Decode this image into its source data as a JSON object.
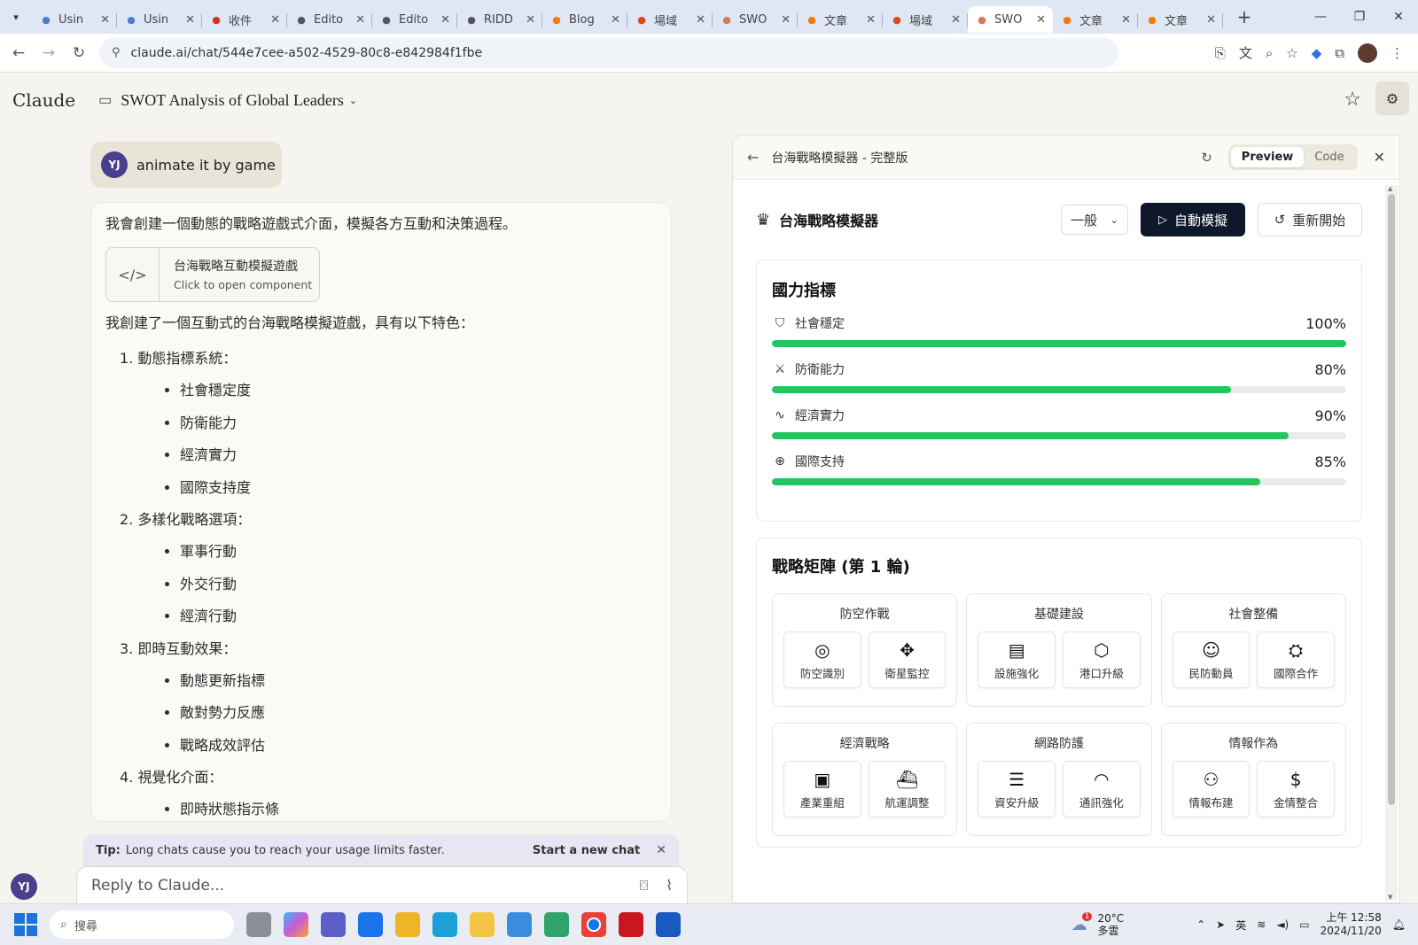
{
  "browser": {
    "tabs": [
      {
        "label": "Usin",
        "icon": "web-icon",
        "color": "#4a7fd0"
      },
      {
        "label": "Usin",
        "icon": "web-icon",
        "color": "#4a7fd0"
      },
      {
        "label": "收件",
        "icon": "gmail-icon",
        "color": "#d93025"
      },
      {
        "label": "Edito",
        "icon": "web-icon",
        "color": "#555555"
      },
      {
        "label": "Edito",
        "icon": "web-icon",
        "color": "#555555"
      },
      {
        "label": "RIDD",
        "icon": "web-icon",
        "color": "#555555"
      },
      {
        "label": "Blog",
        "icon": "blogger-icon",
        "color": "#f57c00"
      },
      {
        "label": "場域",
        "icon": "blogger-icon",
        "color": "#e0451f"
      },
      {
        "label": "SWO",
        "icon": "claude-icon",
        "color": "#d97757"
      },
      {
        "label": "文章",
        "icon": "blogger-icon",
        "color": "#f57c00"
      },
      {
        "label": "場域",
        "icon": "blogger-icon",
        "color": "#e0451f"
      },
      {
        "label": "SWO",
        "icon": "claude-icon",
        "color": "#d97757",
        "active": true
      },
      {
        "label": "文章",
        "icon": "blogger-icon",
        "color": "#f57c00"
      },
      {
        "label": "文章",
        "icon": "blogger-icon",
        "color": "#f57c00"
      }
    ],
    "url": "claude.ai/chat/544e7cee-a502-4529-80c8-e842984f1fbe"
  },
  "claude": {
    "brand": "Claude",
    "chat_title": "SWOT Analysis of Global Leaders"
  },
  "chat": {
    "user_initials": "YJ",
    "user_message": "animate it by game",
    "intro": "我會創建一個動態的戰略遊戲式介面，模擬各方互動和決策過程。",
    "artifact_name": "台海戰略互動模擬遊戲",
    "artifact_sub": "Click to open component",
    "summary": "我創建了一個互動式的台海戰略模擬遊戲，具有以下特色：",
    "features": [
      {
        "title": "1. 動態指標系統：",
        "items": [
          "社會穩定度",
          "防衛能力",
          "經濟實力",
          "國際支持度"
        ]
      },
      {
        "title": "2. 多樣化戰略選項：",
        "items": [
          "軍事行動",
          "外交行動",
          "經濟行動"
        ]
      },
      {
        "title": "3. 即時互動效果：",
        "items": [
          "動態更新指標",
          "敵對勢力反應",
          "戰略成效評估"
        ]
      },
      {
        "title": "4. 視覺化介面：",
        "items": [
          "即時狀態指示條"
        ]
      }
    ],
    "tip_label": "Tip:",
    "tip_text": "Long chats cause you to reach your usage limits faster.",
    "tip_action": "Start a new chat",
    "reply_placeholder": "Reply to Claude..."
  },
  "panel": {
    "title": "台海戰略模擬器 - 完整版",
    "preview_label": "Preview",
    "code_label": "Code",
    "app": {
      "name": "台海戰略模擬器",
      "difficulty": "一般",
      "run_label": "自動模擬",
      "reset_label": "重新開始",
      "indicators_title": "國力指標",
      "indicators": [
        {
          "label": "社會穩定",
          "value": "100%",
          "level": 100,
          "icon": "shield-icon",
          "glyph": "⛉"
        },
        {
          "label": "防衛能力",
          "value": "80%",
          "level": 80,
          "icon": "sword-icon",
          "glyph": "⚔"
        },
        {
          "label": "經濟實力",
          "value": "90%",
          "level": 90,
          "icon": "activity-icon",
          "glyph": "∿"
        },
        {
          "label": "國際支持",
          "value": "85%",
          "level": 85,
          "icon": "globe-icon",
          "glyph": "⊕"
        }
      ],
      "matrix_title": "戰略矩陣 (第 1 輪)",
      "groups": [
        {
          "title": "防空作戰",
          "actions": [
            {
              "label": "防空識別",
              "icon": "radar-icon",
              "glyph": "◎"
            },
            {
              "label": "衛星監控",
              "icon": "satellite-icon",
              "glyph": "✥"
            }
          ]
        },
        {
          "title": "基礎建設",
          "actions": [
            {
              "label": "設施強化",
              "icon": "building-icon",
              "glyph": "▤"
            },
            {
              "label": "港口升級",
              "icon": "box-icon",
              "glyph": "⬡"
            }
          ]
        },
        {
          "title": "社會整備",
          "actions": [
            {
              "label": "民防動員",
              "icon": "users-icon",
              "glyph": "☺"
            },
            {
              "label": "國際合作",
              "icon": "handshake-icon",
              "glyph": "⛭"
            }
          ]
        },
        {
          "title": "經濟戰略",
          "actions": [
            {
              "label": "產業重組",
              "icon": "briefcase-icon",
              "glyph": "▣"
            },
            {
              "label": "航運調整",
              "icon": "ship-icon",
              "glyph": "⛴"
            }
          ]
        },
        {
          "title": "網路防護",
          "actions": [
            {
              "label": "資安升級",
              "icon": "server-icon",
              "glyph": "☰"
            },
            {
              "label": "通訊強化",
              "icon": "wifi-icon",
              "glyph": "◠"
            }
          ]
        },
        {
          "title": "情報作為",
          "actions": [
            {
              "label": "情報布建",
              "icon": "network-icon",
              "glyph": "⚇"
            },
            {
              "label": "金情整合",
              "icon": "dollar-icon",
              "glyph": "$"
            }
          ]
        }
      ]
    }
  },
  "taskbar": {
    "search_placeholder": "搜尋",
    "weather_temp": "20°C",
    "weather_desc": "多雲",
    "weather_badge": "1",
    "ime": "英",
    "time": "上午 12:58",
    "date": "2024/11/20"
  }
}
